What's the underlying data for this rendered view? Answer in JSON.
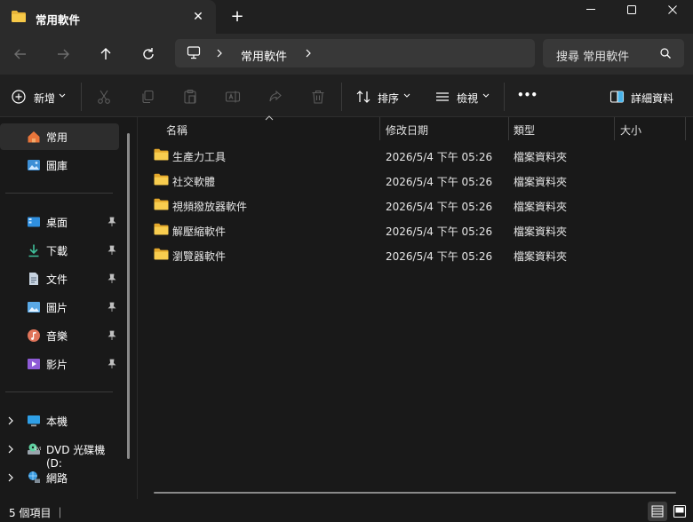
{
  "window": {
    "tab_title": "常用軟件",
    "tab_close": "✕",
    "new_tab": "+"
  },
  "address": {
    "crumbs": [
      "常用軟件"
    ],
    "search_placeholder": "搜尋 常用軟件"
  },
  "toolbar": {
    "new_label": "新增",
    "sort_label": "排序",
    "view_label": "檢視",
    "more_label": "•••",
    "details_label": "詳細資料"
  },
  "sidebar": {
    "top": [
      {
        "label": "常用",
        "icon": "home-icon",
        "selected": true
      },
      {
        "label": "圖庫",
        "icon": "gallery-icon",
        "selected": false
      }
    ],
    "quick": [
      {
        "label": "桌面",
        "icon": "desktop-icon"
      },
      {
        "label": "下載",
        "icon": "download-icon"
      },
      {
        "label": "文件",
        "icon": "document-icon"
      },
      {
        "label": "圖片",
        "icon": "pictures-icon"
      },
      {
        "label": "音樂",
        "icon": "music-icon"
      },
      {
        "label": "影片",
        "icon": "videos-icon"
      }
    ],
    "drives": [
      {
        "label": "本機",
        "icon": "pc-icon"
      },
      {
        "label": "DVD 光碟機 (D:",
        "icon": "dvd-icon"
      },
      {
        "label": "網路",
        "icon": "network-icon"
      }
    ]
  },
  "columns": {
    "name": "名稱",
    "modified": "修改日期",
    "type": "類型",
    "size": "大小"
  },
  "files": [
    {
      "name": "生產力工具",
      "modified": "2026/5/4 下午 05:26",
      "type": "檔案資料夾",
      "size": ""
    },
    {
      "name": "社交軟體",
      "modified": "2026/5/4 下午 05:26",
      "type": "檔案資料夾",
      "size": ""
    },
    {
      "name": "視頻撥放器軟件",
      "modified": "2026/5/4 下午 05:26",
      "type": "檔案資料夾",
      "size": ""
    },
    {
      "name": "解壓縮軟件",
      "modified": "2026/5/4 下午 05:26",
      "type": "檔案資料夾",
      "size": ""
    },
    {
      "name": "瀏覽器軟件",
      "modified": "2026/5/4 下午 05:26",
      "type": "檔案資料夾",
      "size": ""
    }
  ],
  "status": {
    "item_count": "5 個項目 ｜"
  },
  "colors": {
    "folder": "#e8b53a",
    "accent": "#4cc2ff"
  }
}
